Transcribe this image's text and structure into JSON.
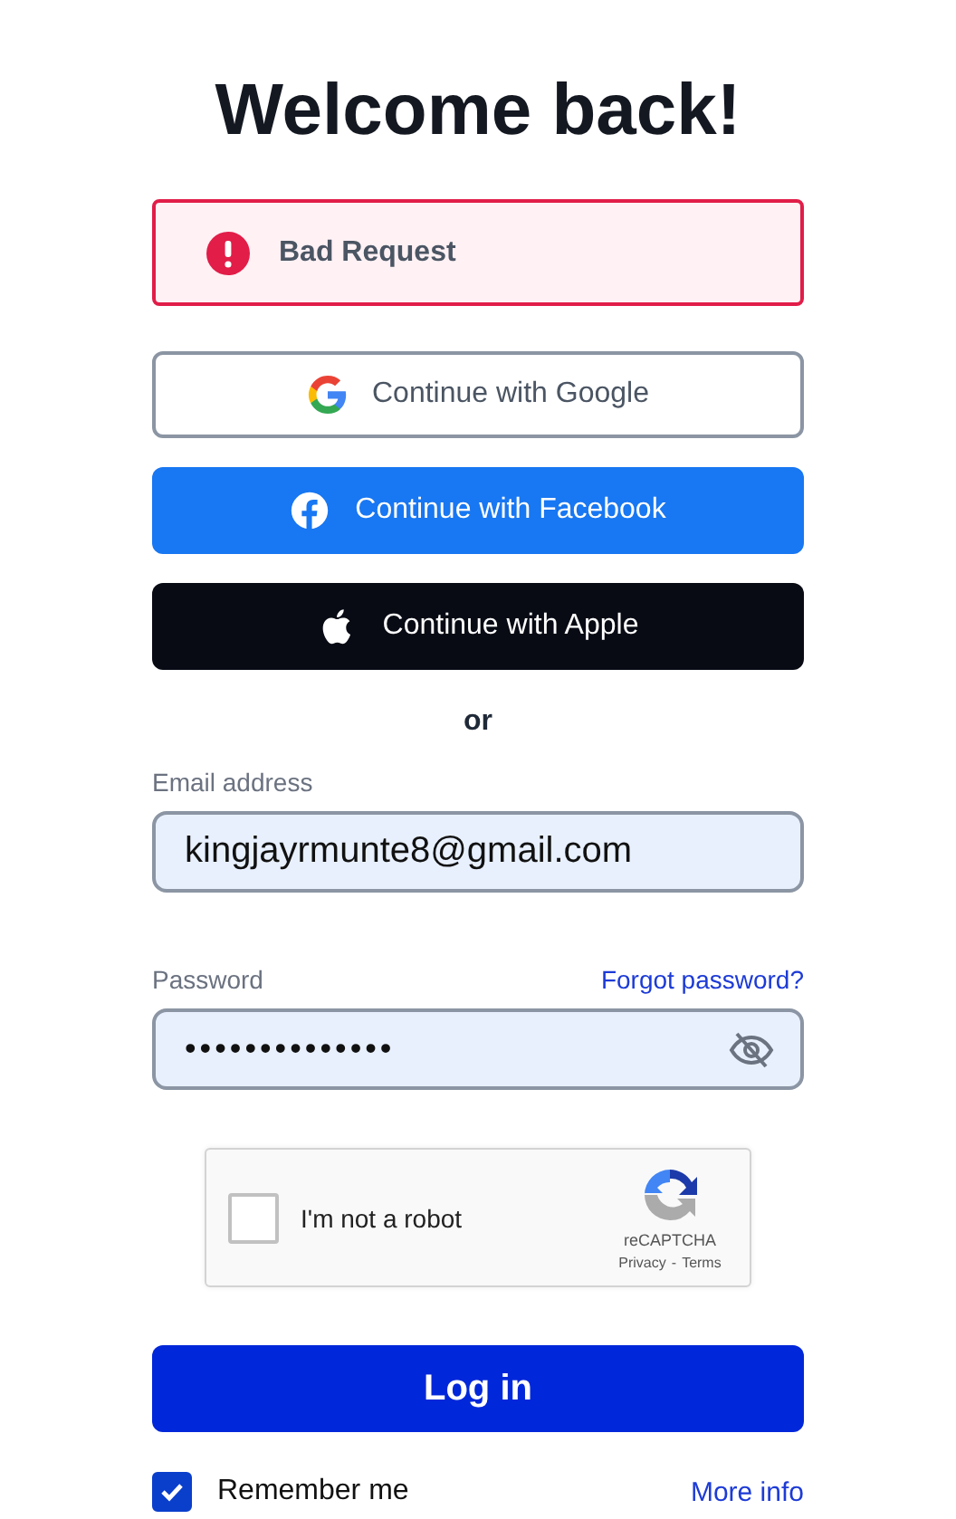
{
  "title": "Welcome back!",
  "alert": {
    "message": "Bad Request"
  },
  "social_buttons": [
    {
      "kind": "google",
      "label": "Continue with Google"
    },
    {
      "kind": "facebook",
      "label": "Continue with Facebook"
    },
    {
      "kind": "apple",
      "label": "Continue with Apple"
    }
  ],
  "divider": "or",
  "email": {
    "label": "Email address",
    "value": "kingjayrmunte8@gmail.com"
  },
  "password": {
    "label": "Password",
    "forgot_link": "Forgot password?",
    "value": "••••••••••••••"
  },
  "captcha": {
    "label": "I'm not a robot",
    "checked": false,
    "brand": "reCAPTCHA",
    "privacy": "Privacy",
    "separator": "-",
    "terms": "Terms"
  },
  "login_button": "Log in",
  "remember": {
    "label": "Remember me",
    "checked": true
  },
  "more_info": "More info"
}
